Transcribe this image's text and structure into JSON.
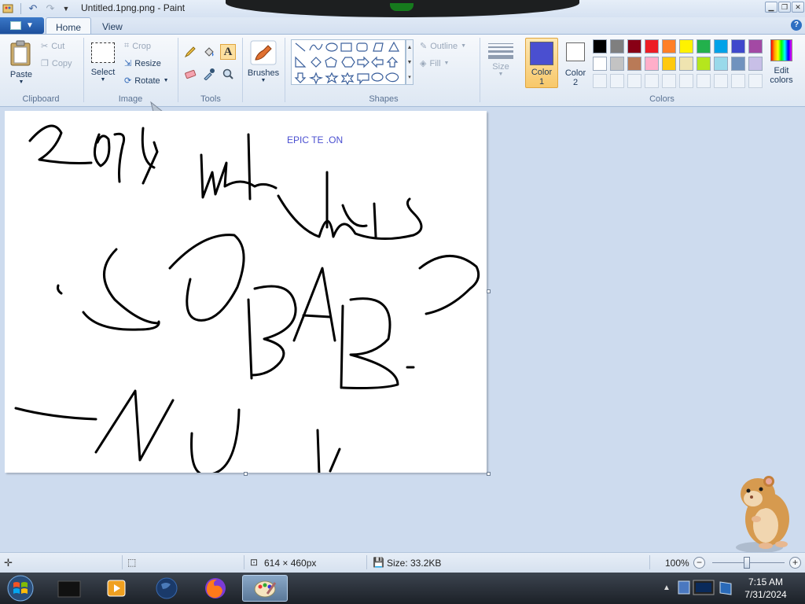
{
  "window": {
    "title": "Untitled.1png.png - Paint"
  },
  "tabs": [
    {
      "label": "Home"
    },
    {
      "label": "View"
    }
  ],
  "clipboard": {
    "paste_label": "Paste",
    "cut_label": "Cut",
    "copy_label": "Copy",
    "group_label": "Clipboard"
  },
  "image": {
    "select_label": "Select",
    "crop_label": "Crop",
    "resize_label": "Resize",
    "rotate_label": "Rotate",
    "group_label": "Image"
  },
  "tools": {
    "group_label": "Tools"
  },
  "brushes": {
    "label": "Brushes"
  },
  "shapes": {
    "outline_label": "Outline",
    "fill_label": "Fill",
    "group_label": "Shapes"
  },
  "size": {
    "label": "Size"
  },
  "colors": {
    "color1_label": "Color",
    "color1_num": "1",
    "color2_label": "Color",
    "color2_num": "2",
    "edit_label": "Edit",
    "edit_label2": "colors",
    "group_label": "Colors",
    "color1_value": "#4a4fd0",
    "color2_value": "#ffffff",
    "row1": [
      "#000000",
      "#7f7f7f",
      "#880015",
      "#ed1c24",
      "#ff7f27",
      "#fff200",
      "#22b14c",
      "#00a2e8",
      "#3f48cc",
      "#a349a4"
    ],
    "row2": [
      "#ffffff",
      "#c3c3c3",
      "#b97a57",
      "#ffaec9",
      "#ffc90e",
      "#efe4b0",
      "#b5e61d",
      "#99d9ea",
      "#7092be",
      "#c8bfe7"
    ]
  },
  "canvas": {
    "overlay_text": "EPIC TE .ON"
  },
  "status": {
    "dimensions": "614 × 460px",
    "size": "Size: 33.2KB",
    "zoom": "100%"
  },
  "taskbar": {
    "time": "7:15 AM",
    "date": "7/31/2024"
  }
}
